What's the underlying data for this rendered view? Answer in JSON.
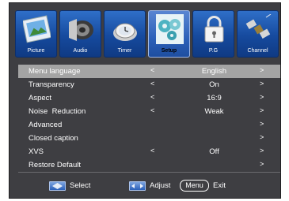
{
  "tabs": [
    {
      "label": "Picture",
      "icon": "picture-icon",
      "active": false
    },
    {
      "label": "Audio",
      "icon": "audio-icon",
      "active": false
    },
    {
      "label": "Timer",
      "icon": "timer-icon",
      "active": false
    },
    {
      "label": "Setup",
      "icon": "setup-icon",
      "active": true
    },
    {
      "label": "P.G",
      "icon": "lock-icon",
      "active": false
    },
    {
      "label": "Channel",
      "icon": "satellite-icon",
      "active": false
    }
  ],
  "menu": {
    "rows": [
      {
        "name": "Menu language",
        "value": "English",
        "left_arrow": true,
        "right_arrow": true,
        "selected": true
      },
      {
        "name": "Transparency",
        "value": "On",
        "left_arrow": true,
        "right_arrow": true,
        "selected": false
      },
      {
        "name": "Aspect",
        "value": "16:9",
        "left_arrow": true,
        "right_arrow": true,
        "selected": false
      },
      {
        "name": "Noise  Reduction",
        "value": "Weak",
        "left_arrow": true,
        "right_arrow": true,
        "selected": false
      },
      {
        "name": "Advanced",
        "value": "",
        "left_arrow": false,
        "right_arrow": true,
        "selected": false
      },
      {
        "name": "Closed caption",
        "value": "",
        "left_arrow": false,
        "right_arrow": true,
        "selected": false
      },
      {
        "name": "XVS",
        "value": "Off",
        "left_arrow": true,
        "right_arrow": true,
        "selected": false
      },
      {
        "name": "Restore Default",
        "value": "",
        "left_arrow": false,
        "right_arrow": true,
        "selected": false
      }
    ]
  },
  "arrows": {
    "left": "<",
    "right": ">"
  },
  "footer": {
    "select_label": "Select",
    "adjust_label": "Adjust",
    "menu_key": "Menu",
    "exit_label": "Exit"
  }
}
